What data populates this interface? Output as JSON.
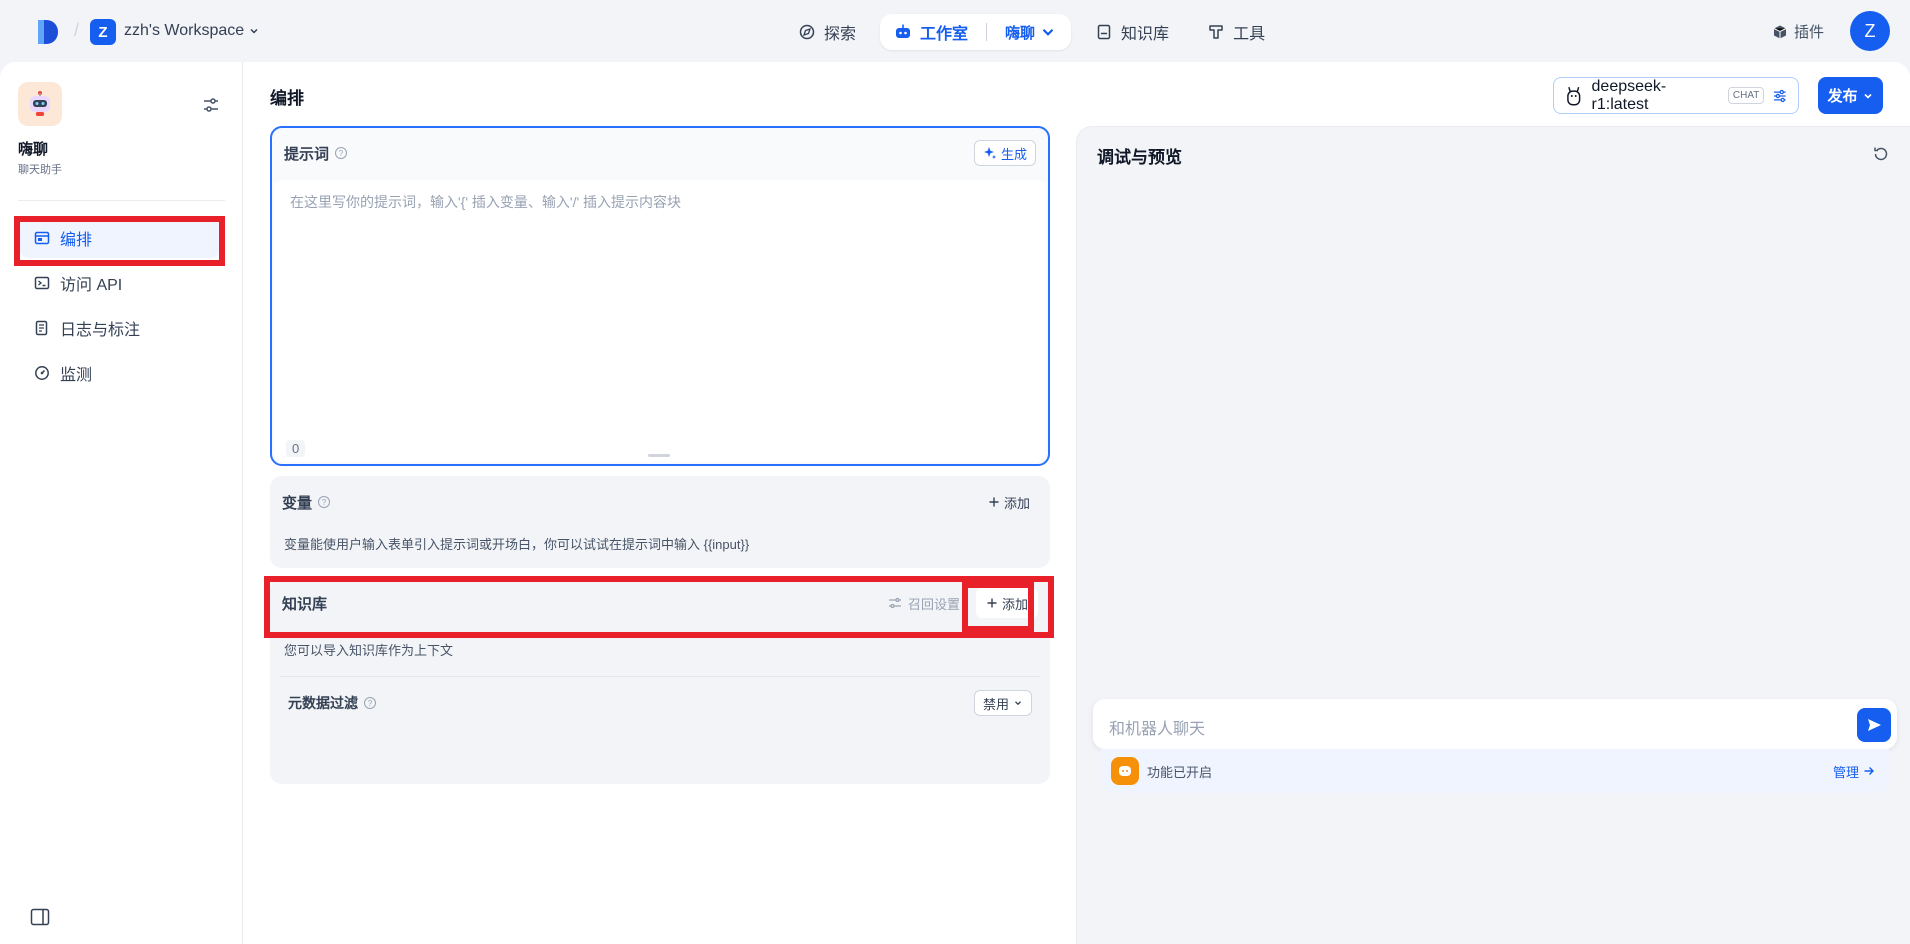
{
  "topbar": {
    "workspace_initial": "Z",
    "workspace_name": "zzh's Workspace",
    "nav": {
      "explore": "探索",
      "studio": "工作室",
      "current_app": "嗨聊",
      "knowledge": "知识库",
      "tools": "工具"
    },
    "plugins": "插件",
    "avatar_initial": "Z"
  },
  "sidebar": {
    "app_name": "嗨聊",
    "app_desc": "聊天助手",
    "items": [
      {
        "label": "编排",
        "icon": "layout-icon",
        "active": true
      },
      {
        "label": "访问 API",
        "icon": "terminal-icon",
        "active": false
      },
      {
        "label": "日志与标注",
        "icon": "document-icon",
        "active": false
      },
      {
        "label": "监测",
        "icon": "gauge-icon",
        "active": false
      }
    ]
  },
  "editor": {
    "title": "编排",
    "model_name": "deepseek-r1:latest",
    "model_tag": "CHAT",
    "publish": "发布",
    "prompt": {
      "title": "提示词",
      "generate": "生成",
      "placeholder": "在这里写你的提示词，输入'{' 插入变量、输入'/' 插入提示内容块",
      "char_count": "0"
    },
    "variables": {
      "title": "变量",
      "add": "添加",
      "desc": "变量能使用户输入表单引入提示词或开场白，你可以试试在提示词中输入 {{input}}"
    },
    "knowledge": {
      "title": "知识库",
      "recall_settings": "召回设置",
      "add": "添加",
      "desc": "您可以导入知识库作为上下文",
      "metadata_filter": "元数据过滤",
      "metadata_value": "禁用"
    }
  },
  "debug": {
    "title": "调试与预览",
    "chat_placeholder": "和机器人聊天",
    "features_enabled": "功能已开启",
    "manage": "管理"
  },
  "colors": {
    "primary": "#155eef",
    "highlight": "#e8202a",
    "feature_icon": "#f79009"
  }
}
